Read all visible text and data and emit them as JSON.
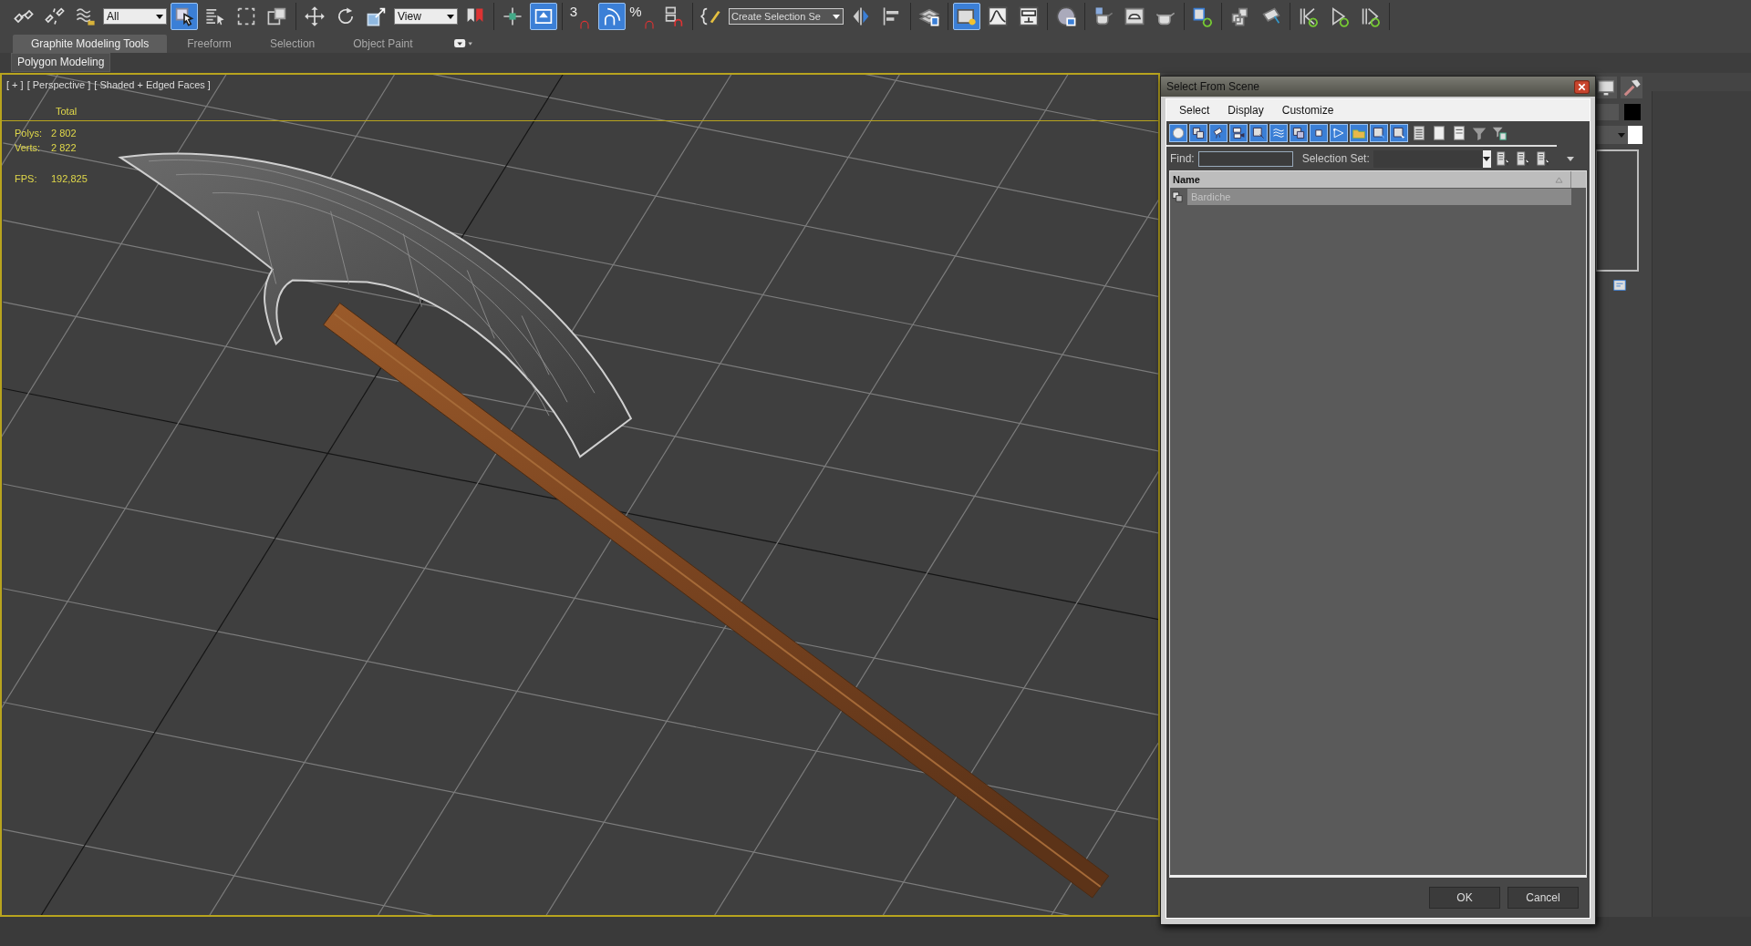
{
  "main_toolbar": {
    "groups": [
      {
        "items": [
          {
            "kind": "link",
            "selected": false
          },
          {
            "kind": "unlink",
            "selected": false
          },
          {
            "kind": "wave",
            "selected": false
          },
          {
            "kind": "dropdown",
            "value": "All"
          },
          {
            "kind": "cursor",
            "selected": true
          },
          {
            "kind": "namelist",
            "selected": false
          },
          {
            "kind": "region",
            "selected": false
          },
          {
            "kind": "crossing",
            "selected": false
          }
        ]
      },
      {
        "items": [
          {
            "kind": "move",
            "selected": false
          },
          {
            "kind": "rotate",
            "selected": false
          },
          {
            "kind": "scale",
            "selected": false
          },
          {
            "kind": "dropdown",
            "value": "View"
          },
          {
            "kind": "mirrorsel",
            "selected": false
          }
        ]
      },
      {
        "items": [
          {
            "kind": "pivot",
            "selected": false
          },
          {
            "kind": "manipulate",
            "selected": true
          }
        ]
      },
      {
        "items": [
          {
            "kind": "snap",
            "label": "3",
            "selected": false
          },
          {
            "kind": "anglesnap",
            "selected": true
          },
          {
            "kind": "snap",
            "label": "%",
            "selected": false
          },
          {
            "kind": "spinnersnap",
            "selected": false
          }
        ]
      },
      {
        "items": [
          {
            "kind": "braces",
            "selected": false
          },
          {
            "kind": "field",
            "value": "Create Selection Se"
          },
          {
            "kind": "mirrorbar",
            "selected": false
          },
          {
            "kind": "align",
            "selected": false
          }
        ]
      },
      {
        "items": [
          {
            "kind": "layers",
            "selected": false
          }
        ]
      },
      {
        "items": [
          {
            "kind": "explorer",
            "selected": true
          },
          {
            "kind": "curve",
            "selected": false
          },
          {
            "kind": "schematic",
            "selected": false
          }
        ]
      },
      {
        "items": [
          {
            "kind": "sphere",
            "selected": false
          }
        ]
      },
      {
        "items": [
          {
            "kind": "teapot",
            "selected": false
          },
          {
            "kind": "frame",
            "selected": false
          },
          {
            "kind": "render",
            "selected": false
          }
        ]
      },
      {
        "items": [
          {
            "kind": "dots",
            "selected": false
          }
        ]
      },
      {
        "items": [
          {
            "kind": "cubes",
            "selected": false
          },
          {
            "kind": "cylinder",
            "selected": false
          }
        ]
      },
      {
        "items": [
          {
            "kind": "keyprev",
            "selected": false
          },
          {
            "kind": "keyplay",
            "selected": false
          },
          {
            "kind": "keynext",
            "selected": false
          }
        ]
      }
    ]
  },
  "ribbon": {
    "tabs": [
      {
        "label": "Graphite Modeling Tools",
        "selected": true
      },
      {
        "label": "Freeform",
        "selected": false
      },
      {
        "label": "Selection",
        "selected": false
      },
      {
        "label": "Object Paint",
        "selected": false
      }
    ],
    "panel_label": "Polygon Modeling"
  },
  "viewport": {
    "labels": [
      "[ + ]",
      "[ Perspective ]",
      "[ Shaded + Edged Faces ]"
    ],
    "stats_header": "Total",
    "stats": [
      {
        "label": "Polys:",
        "value": "2 802"
      },
      {
        "label": "Verts:",
        "value": "2 822"
      }
    ],
    "fps": {
      "label": "FPS:",
      "value": "192,825"
    }
  },
  "dialog": {
    "title": "Select From Scene",
    "menu": [
      "Select",
      "Display",
      "Customize"
    ],
    "filters": [
      {
        "kind": "geometry",
        "selected": true
      },
      {
        "kind": "shape",
        "selected": true
      },
      {
        "kind": "light",
        "selected": true
      },
      {
        "kind": "camera",
        "selected": true
      },
      {
        "kind": "helper",
        "selected": true
      },
      {
        "kind": "warp",
        "selected": true
      },
      {
        "kind": "group",
        "selected": true
      },
      {
        "kind": "xref",
        "selected": true
      },
      {
        "kind": "bone",
        "selected": true
      },
      {
        "kind": "container",
        "selected": true
      },
      {
        "kind": "frozen",
        "selected": true
      },
      {
        "kind": "hidden",
        "selected": true
      },
      {
        "kind": "all",
        "selected": false
      },
      {
        "kind": "none",
        "selected": false
      },
      {
        "kind": "invert",
        "selected": false
      },
      {
        "kind": "filter",
        "selected": false
      },
      {
        "kind": "filterlist",
        "selected": false
      }
    ],
    "find_label": "Find:",
    "selection_set_label": "Selection Set:",
    "column": "Name",
    "rows": [
      {
        "name": "Bardiche",
        "selected": true
      }
    ],
    "buttons": [
      "OK",
      "Cancel"
    ]
  }
}
